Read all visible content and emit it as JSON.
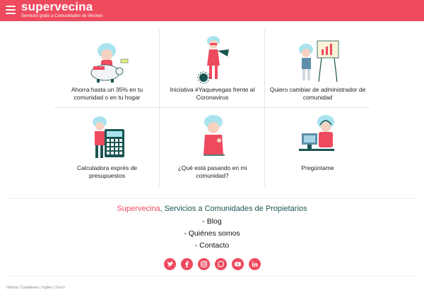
{
  "header": {
    "brand": "supervecina",
    "tagline": "Servicios gratis a Comunidades de Vecinos"
  },
  "tiles": [
    {
      "label": "Ahorra hasta un 35% en tu comunidad o en tu hogar",
      "icon": "piggy-bank-illustration"
    },
    {
      "label": "Iniciativa #Yaquevegas frente al Coronavirus",
      "icon": "superhero-illustration"
    },
    {
      "label": "Quiero cambiar de administrador de comunidad",
      "icon": "presentation-board-illustration"
    },
    {
      "label": "Calculadora exprés de presupuestos",
      "icon": "calculator-illustration"
    },
    {
      "label": "¿Qué está pasando en mi comunidad?",
      "icon": "thinking-illustration"
    },
    {
      "label": "Pregúntame",
      "icon": "operator-headset-illustration"
    }
  ],
  "footer": {
    "brand": "Supervecina",
    "title_rest": ", Servicios a Comunidades de Propietarios",
    "links": [
      "- Blog",
      "- Quiénes somos",
      "- Contacto"
    ],
    "social": [
      "twitter-icon",
      "facebook-icon",
      "instagram-icon",
      "whatsapp-icon",
      "youtube-icon",
      "linkedin-icon"
    ],
    "languages": [
      "Idioma:",
      "Castellano",
      "|",
      "Inglés",
      "|",
      "Turco"
    ]
  },
  "colors": {
    "accent": "#ee4a5e",
    "teal_dark": "#1a5552",
    "hair": "#a9e4ee"
  }
}
